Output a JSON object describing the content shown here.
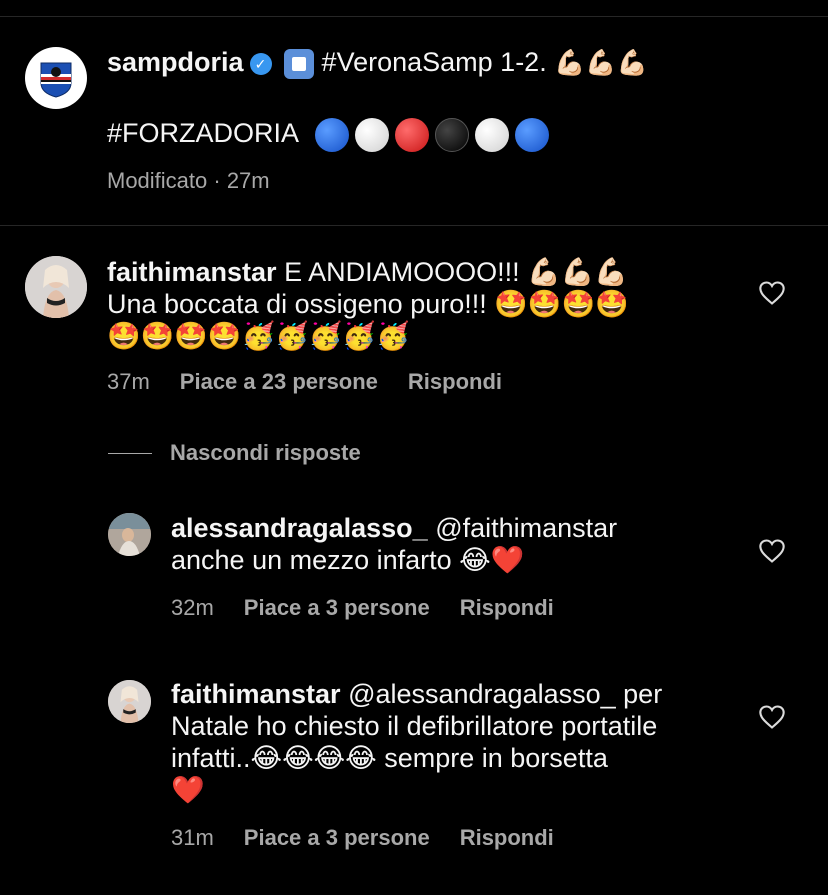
{
  "post": {
    "username": "sampdoria",
    "hashtag1": "#VeronaSamp 1-2.",
    "emoji1": "💪🏻💪🏻💪🏻",
    "hashtag2": "#FORZADORIA",
    "edited": "Modificato · 27m"
  },
  "comments": [
    {
      "username": "faithimanstar",
      "line1": "E ANDIAMOOOO!!! 💪🏻💪🏻💪🏻",
      "line2": "Una boccata di ossigeno puro!!! 🤩🤩🤩🤩",
      "line3": "🤩🤩🤩🤩🥳🥳🥳🥳🥳",
      "time": "37m",
      "likes": "Piace a 23 persone",
      "reply": "Rispondi"
    }
  ],
  "hide_replies": "Nascondi risposte",
  "replies": [
    {
      "username": "alessandragalasso_",
      "mention": "@faithimanstar",
      "line2": "anche un mezzo infarto 😂❤️",
      "time": "32m",
      "likes": "Piace a 3 persone",
      "reply": "Rispondi"
    },
    {
      "username": "faithimanstar",
      "mention": "@alessandragalasso_",
      "line1_rest": "per",
      "line2": "Natale ho chiesto il defibrillatore portatile",
      "line3": "infatti..😂😂😂😂 sempre in borsetta",
      "line4": "❤️",
      "time": "31m",
      "likes": "Piace a 3 persone",
      "reply": "Rispondi"
    }
  ],
  "colors": {
    "background": "#000000",
    "text": "#f5f5f5",
    "meta": "#a8a8a8",
    "verified": "#3897f0"
  }
}
